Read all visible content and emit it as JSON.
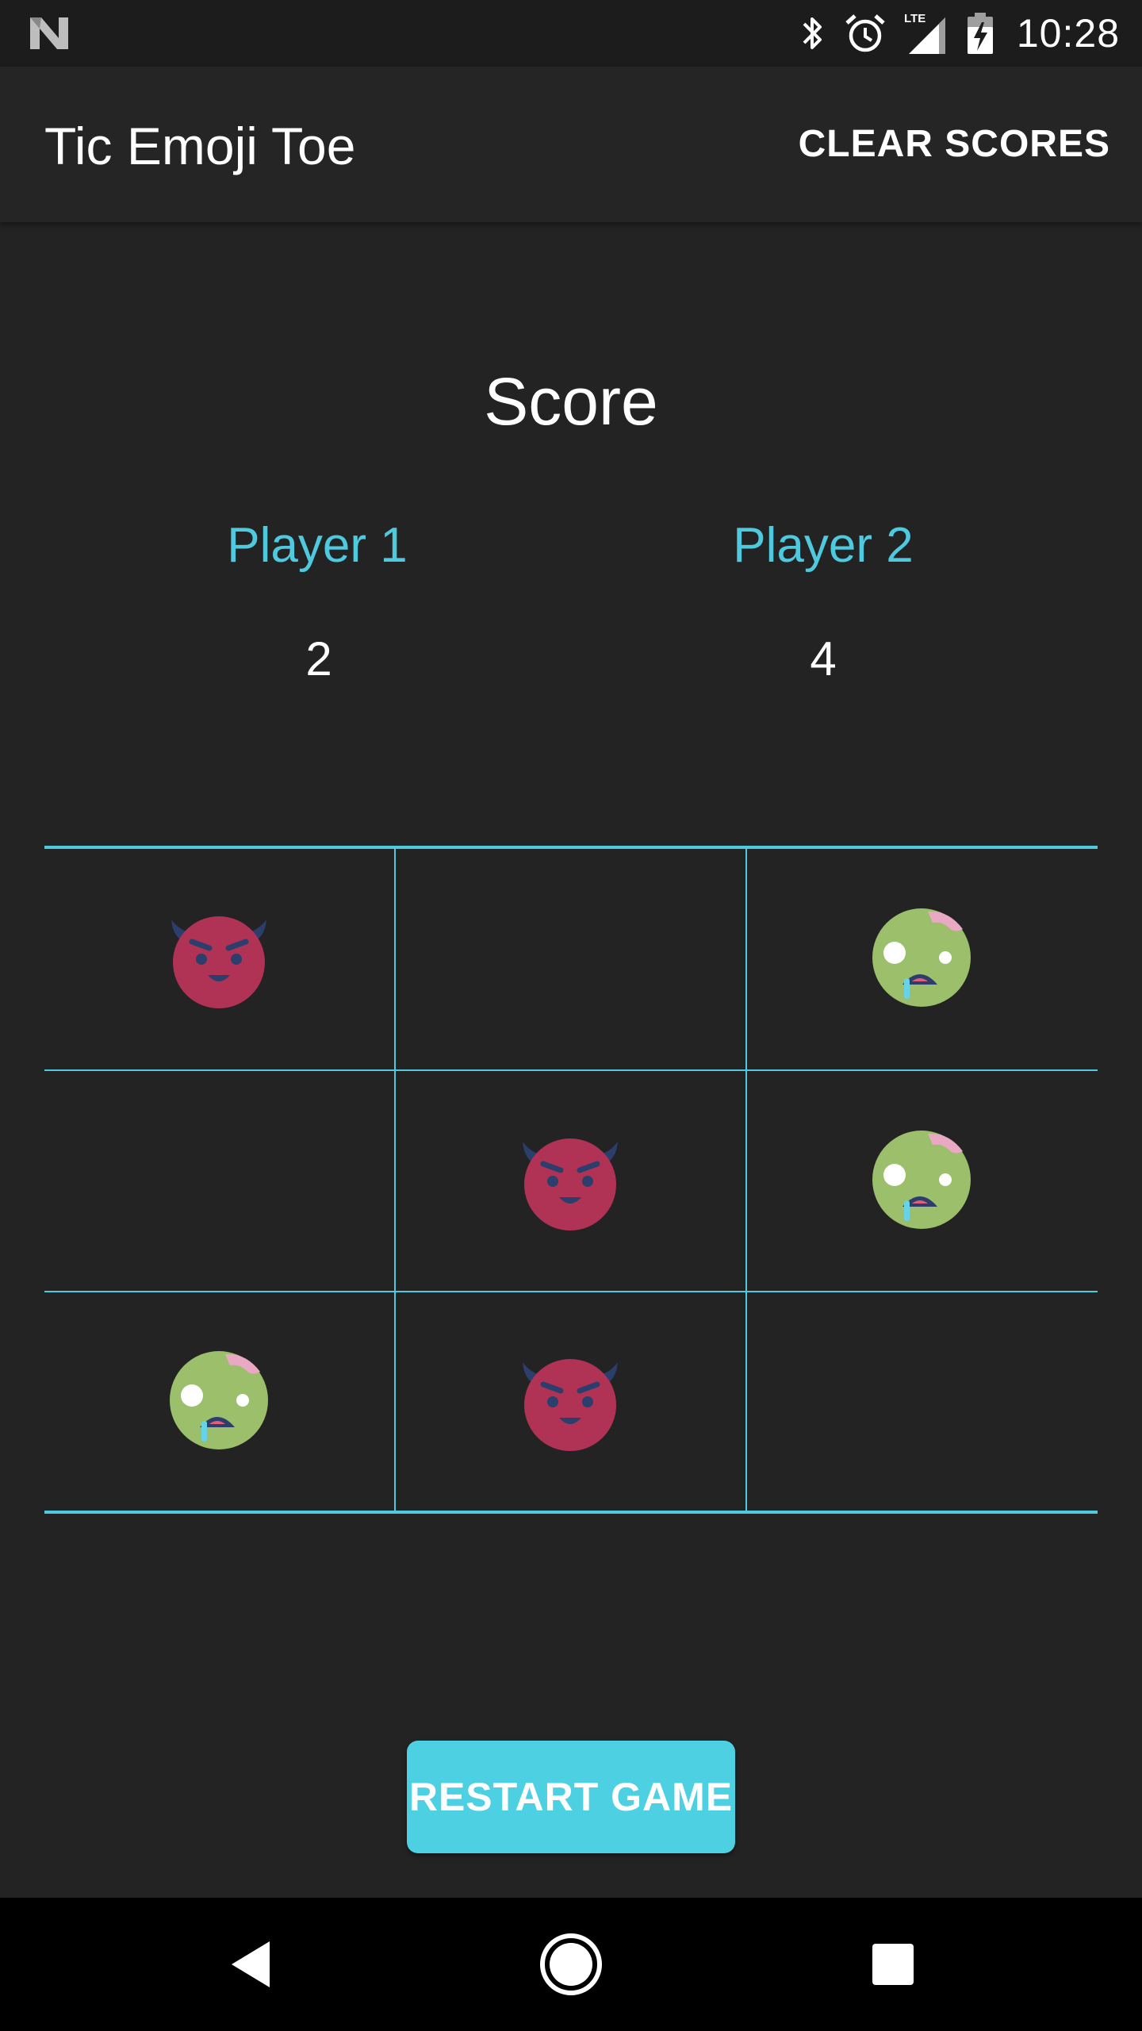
{
  "status_bar": {
    "time": "10:28",
    "network": "LTE"
  },
  "app_bar": {
    "title": "Tic Emoji Toe",
    "clear_scores_label": "CLEAR SCORES"
  },
  "scoreboard": {
    "title": "Score",
    "player1": {
      "label": "Player 1",
      "score": "2"
    },
    "player2": {
      "label": "Player 2",
      "score": "4"
    }
  },
  "board": {
    "cells": [
      [
        "devil",
        "",
        "zombie"
      ],
      [
        "",
        "devil",
        "zombie"
      ],
      [
        "zombie",
        "devil",
        ""
      ]
    ]
  },
  "restart_label": "RESTART GAME",
  "colors": {
    "accent": "#4ec9de",
    "button": "#4dd0e1",
    "background": "#232323",
    "devil": "#b03356",
    "zombie": "#9bbf6a"
  }
}
